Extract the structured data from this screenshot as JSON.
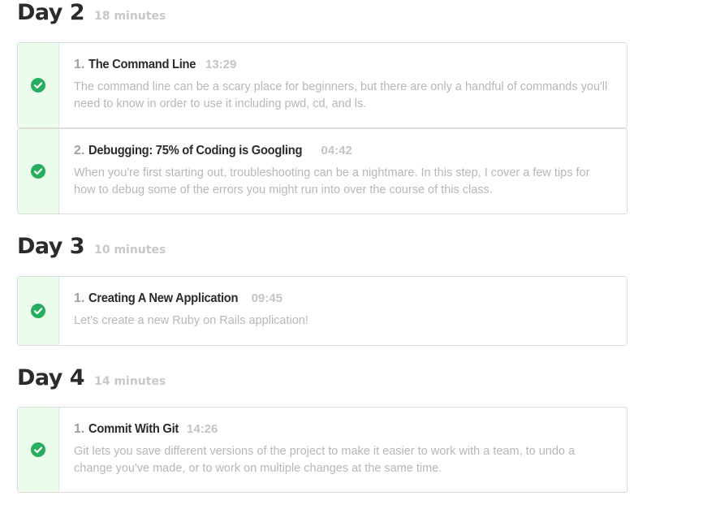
{
  "days": [
    {
      "title": "Day 2",
      "duration": "18 minutes",
      "lessons": [
        {
          "number": "1.",
          "title": "The Command Line",
          "time": "13:29",
          "description": "The command line can be a scary place for beginners, but there are only a handful of commands you'll need to know in order to use it including pwd, cd, and ls.",
          "status_icon": "check-circle-icon"
        },
        {
          "number": "2.",
          "title": "Debugging: 75% of Coding is Googling",
          "time": "04:42",
          "description": "When you're first starting out, troubleshooting can be a nightmare. In this step, I cover a few tips for how to debug some of the errors you might run into over the course of this class.",
          "status_icon": "check-circle-icon"
        }
      ]
    },
    {
      "title": "Day 3",
      "duration": "10 minutes",
      "lessons": [
        {
          "number": "1.",
          "title": "Creating A New Application",
          "time": "09:45",
          "description": "Let's create a new Ruby on Rails application!",
          "status_icon": "check-circle-icon"
        }
      ]
    },
    {
      "title": "Day 4",
      "duration": "14 minutes",
      "lessons": [
        {
          "number": "1.",
          "title": "Commit With Git",
          "time": "14:26",
          "description": "Git lets you save different versions of the project to make it easier to work with a team, to undo a change you've made, or to work on multiple changes at the same time.",
          "status_icon": "check-circle-icon"
        }
      ]
    }
  ],
  "colors": {
    "check": "#27ae60",
    "status_bg": "#ecfcec",
    "title": "#2b2b2b",
    "muted": "#b7b7b7"
  }
}
